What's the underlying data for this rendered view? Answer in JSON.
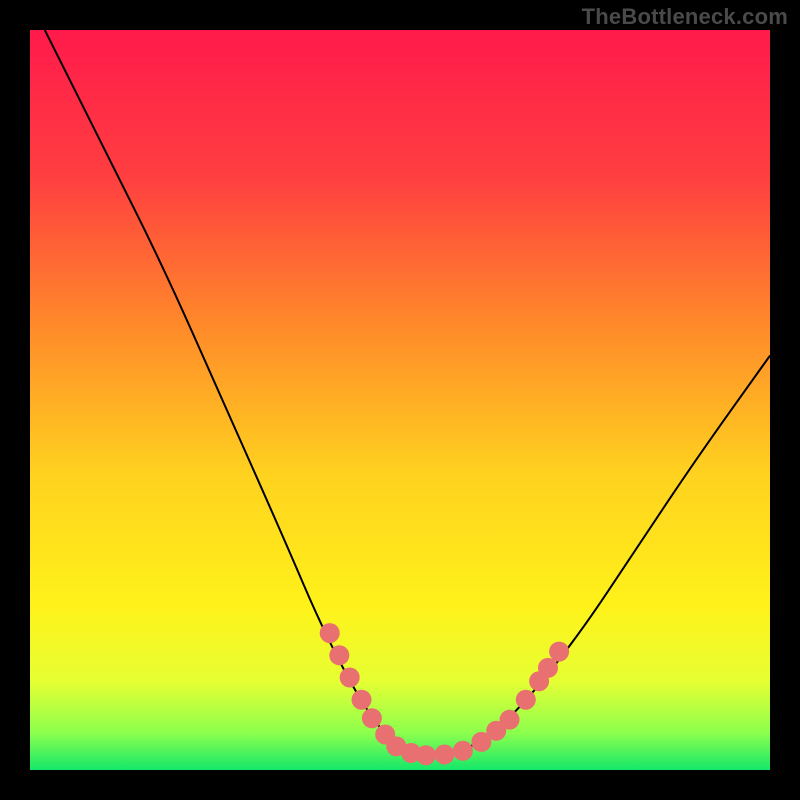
{
  "watermark": "TheBottleneck.com",
  "chart_data": {
    "type": "line",
    "title": "",
    "xlabel": "",
    "ylabel": "",
    "xlim": [
      0,
      100
    ],
    "ylim": [
      0,
      100
    ],
    "grid": false,
    "legend": false,
    "gradient_stops": [
      {
        "offset": 0,
        "color": "#ff1a4b"
      },
      {
        "offset": 20,
        "color": "#ff3f40"
      },
      {
        "offset": 40,
        "color": "#ff8a2a"
      },
      {
        "offset": 60,
        "color": "#ffd21f"
      },
      {
        "offset": 78,
        "color": "#fff21a"
      },
      {
        "offset": 88,
        "color": "#e6ff33"
      },
      {
        "offset": 95,
        "color": "#8cff4d"
      },
      {
        "offset": 100,
        "color": "#14e86a"
      }
    ],
    "series": [
      {
        "name": "bottleneck-curve",
        "color": "#000000",
        "stroke_width": 2,
        "points": [
          {
            "x": 2,
            "y": 100
          },
          {
            "x": 10,
            "y": 84
          },
          {
            "x": 18,
            "y": 68
          },
          {
            "x": 26,
            "y": 50
          },
          {
            "x": 34,
            "y": 32
          },
          {
            "x": 40,
            "y": 18
          },
          {
            "x": 46,
            "y": 7
          },
          {
            "x": 50,
            "y": 3
          },
          {
            "x": 55,
            "y": 2
          },
          {
            "x": 60,
            "y": 3
          },
          {
            "x": 66,
            "y": 8
          },
          {
            "x": 74,
            "y": 18
          },
          {
            "x": 82,
            "y": 30
          },
          {
            "x": 90,
            "y": 42
          },
          {
            "x": 100,
            "y": 56
          }
        ]
      },
      {
        "name": "highlight-dots",
        "color": "#e87070",
        "marker": true,
        "marker_size": 10,
        "points": [
          {
            "x": 40.5,
            "y": 18.5
          },
          {
            "x": 41.8,
            "y": 15.5
          },
          {
            "x": 43.2,
            "y": 12.5
          },
          {
            "x": 44.8,
            "y": 9.5
          },
          {
            "x": 46.2,
            "y": 7.0
          },
          {
            "x": 48.0,
            "y": 4.8
          },
          {
            "x": 49.5,
            "y": 3.2
          },
          {
            "x": 51.5,
            "y": 2.3
          },
          {
            "x": 53.5,
            "y": 2.0
          },
          {
            "x": 56.0,
            "y": 2.1
          },
          {
            "x": 58.5,
            "y": 2.6
          },
          {
            "x": 61.0,
            "y": 3.8
          },
          {
            "x": 63.0,
            "y": 5.3
          },
          {
            "x": 64.8,
            "y": 6.8
          },
          {
            "x": 67.0,
            "y": 9.5
          },
          {
            "x": 68.8,
            "y": 12.0
          },
          {
            "x": 70.0,
            "y": 13.8
          },
          {
            "x": 71.5,
            "y": 16.0
          }
        ]
      }
    ]
  }
}
